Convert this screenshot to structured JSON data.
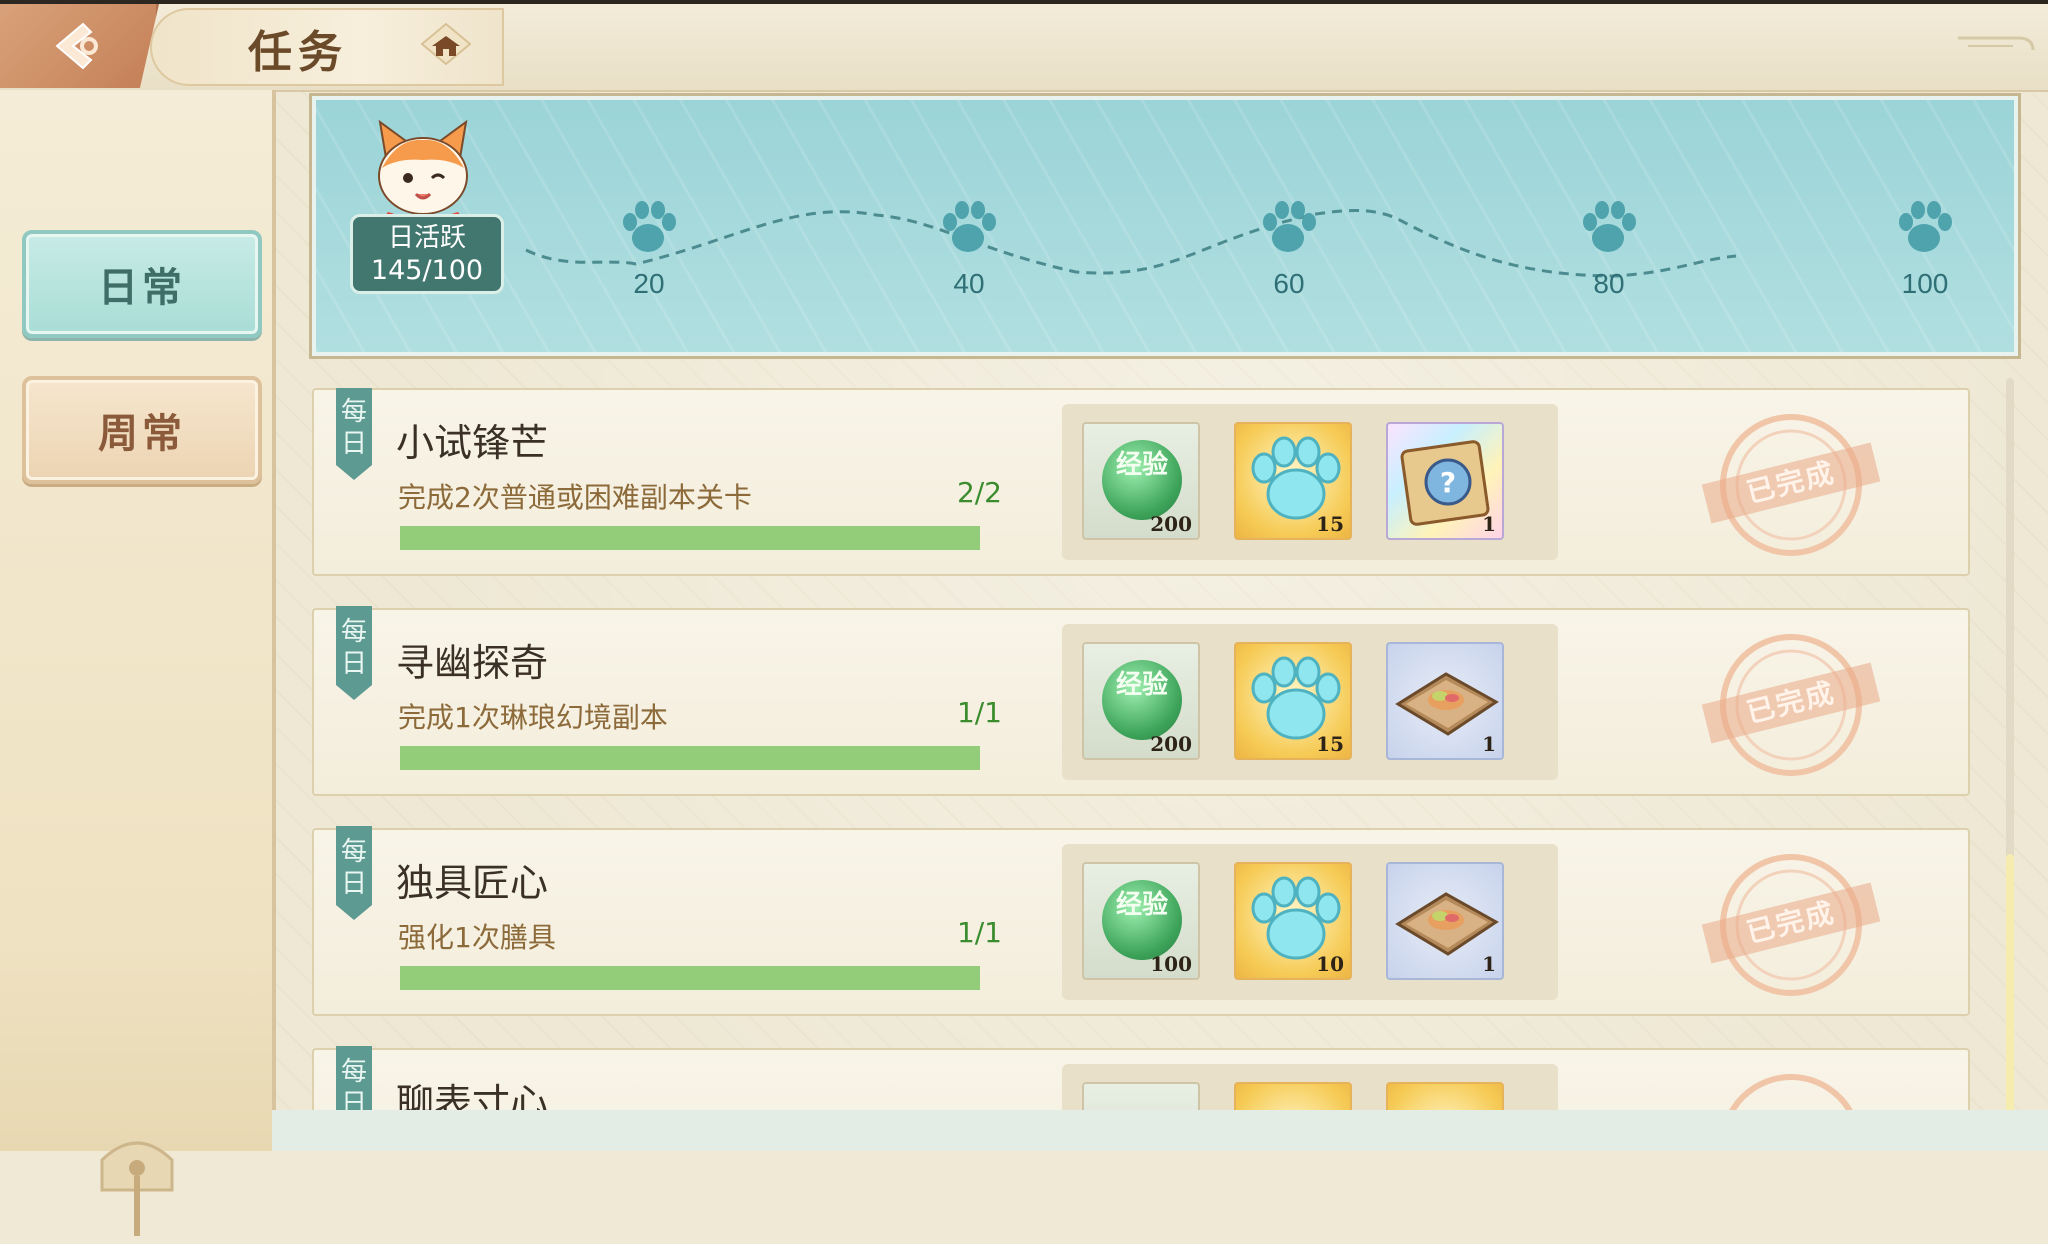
{
  "header": {
    "title": "任务"
  },
  "sidebar": {
    "tabs": [
      {
        "label": "日常",
        "active": true
      },
      {
        "label": "周常",
        "active": false
      }
    ]
  },
  "activity": {
    "label": "日活跃",
    "value": "145/100",
    "milestones": [
      "20",
      "40",
      "60",
      "80",
      "100"
    ]
  },
  "tasks": [
    {
      "tag": "每日",
      "name": "小试锋芒",
      "description": "完成2次普通或困难副本关卡",
      "progress": "2/2",
      "progress_fraction": 1.0,
      "rewards": [
        {
          "type": "exp",
          "label": "经验",
          "qty": "200"
        },
        {
          "type": "paw-token",
          "qty": "15"
        },
        {
          "type": "mystery-box",
          "qty": "1"
        }
      ],
      "status": "已完成"
    },
    {
      "tag": "每日",
      "name": "寻幽探奇",
      "description": "完成1次琳琅幻境副本",
      "progress": "1/1",
      "progress_fraction": 1.0,
      "rewards": [
        {
          "type": "exp",
          "label": "经验",
          "qty": "200"
        },
        {
          "type": "paw-token",
          "qty": "15"
        },
        {
          "type": "food-platter",
          "qty": "1"
        }
      ],
      "status": "已完成"
    },
    {
      "tag": "每日",
      "name": "独具匠心",
      "description": "强化1次膳具",
      "progress": "1/1",
      "progress_fraction": 1.0,
      "rewards": [
        {
          "type": "exp",
          "label": "经验",
          "qty": "100"
        },
        {
          "type": "paw-token",
          "qty": "10"
        },
        {
          "type": "food-platter",
          "qty": "1"
        }
      ],
      "status": "已完成"
    },
    {
      "tag": "每日",
      "name": "聊表寸心"
    }
  ],
  "colors": {
    "teal_accent": "#5d9a91",
    "progress_green": "#93cd7a",
    "progress_text": "#3b8c2e",
    "stamp": "#e9aa89"
  }
}
